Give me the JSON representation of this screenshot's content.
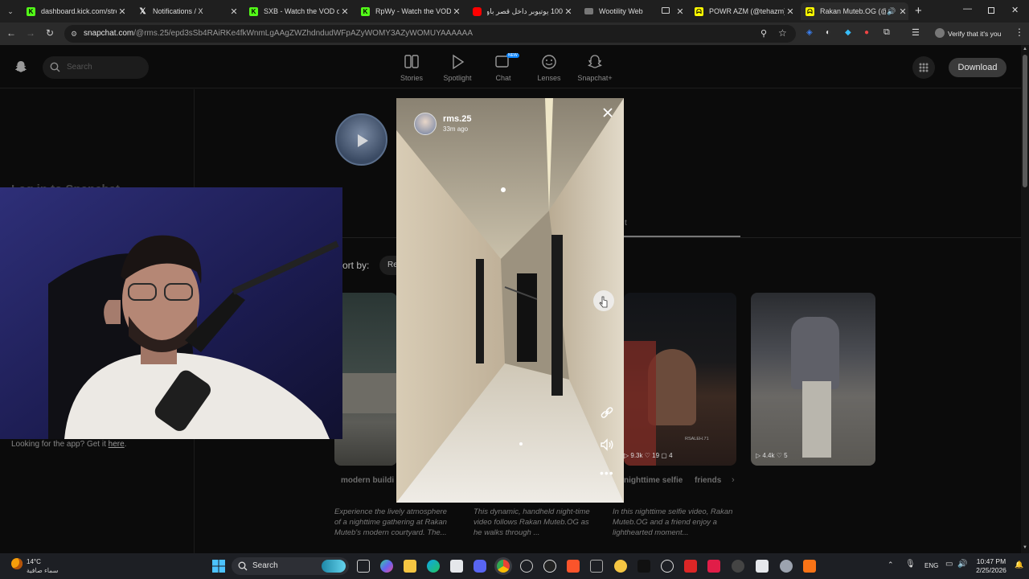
{
  "browser": {
    "tabs": [
      {
        "title": "dashboard.kick.com/strea",
        "icon": "kick-icon",
        "color": "#53fc18"
      },
      {
        "title": "Notifications / X",
        "icon": "x-icon",
        "color": "#ffffff"
      },
      {
        "title": "SXB - Watch the VOD on",
        "icon": "kick-icon",
        "color": "#53fc18"
      },
      {
        "title": "RpWy - Watch the VOD o",
        "icon": "kick-icon",
        "color": "#53fc18"
      },
      {
        "title": "100 يوتيوبر داخل قصر باور",
        "icon": "youtube-icon",
        "color": "#ff0000"
      },
      {
        "title": "Wootility Web",
        "icon": "wooting-icon",
        "color": "#888888"
      },
      {
        "title": "POWR AZM (@tehazm) |",
        "icon": "snapchat-icon",
        "color": "#fffc00"
      },
      {
        "title": "Rakan Muteb.OG (@",
        "icon": "snapchat-icon",
        "color": "#fffc00",
        "active": true
      }
    ],
    "url_host": "snapchat.com",
    "url_path": "/@rms.25/epd3sSb4RAiRKe4fkWnmLgAAgZWZhdndudWFpAZyWOMY3AZyWOMUYAAAAAA",
    "profile_label": "Verify that it's you"
  },
  "snapchat": {
    "search_placeholder": "Search",
    "nav": [
      {
        "label": "Stories",
        "icon": "stories-icon"
      },
      {
        "label": "Spotlight",
        "icon": "spotlight-play-icon"
      },
      {
        "label": "Chat",
        "icon": "chat-icon",
        "badge": "NEW"
      },
      {
        "label": "Lenses",
        "icon": "lenses-icon"
      },
      {
        "label": "Snapchat+",
        "icon": "snapchat-plus-icon"
      }
    ],
    "download_label": "Download",
    "left_pane_fragment": "Log in to Snapchat",
    "tab_fragment": "t",
    "sort_label": "ort by:",
    "sort_value": "Re",
    "app_prompt": "Looking for the app? Get it",
    "app_link": "here",
    "app_prompt_end": "."
  },
  "story": {
    "username": "rms.25",
    "time_ago": "33m ago"
  },
  "cards": [
    {
      "stat_views": "",
      "stat_likes": "",
      "stat_comments": "",
      "tag": "modern buildi",
      "desc": "Experience the lively atmosphere of a nighttime gathering at Rakan Muteb's modern courtyard. The..."
    },
    {
      "stat_views": "",
      "stat_likes": "",
      "stat_comments": "",
      "tag": "",
      "desc": "This dynamic, handheld night-time video follows Rakan Muteb.OG as he walks through ..."
    },
    {
      "stat_views": "9.3k",
      "stat_likes": "19",
      "stat_comments": "4",
      "tag": "nighttime selfie",
      "tag2": "friends",
      "desc": "In this nighttime selfie video, Rakan Muteb.OG and a friend enjoy a lighthearted moment..."
    },
    {
      "stat_views": "4.4k",
      "stat_likes": "5",
      "stat_comments": "",
      "tag": "",
      "desc": ""
    }
  ],
  "card3_watermark": "RSALEH.71",
  "taskbar": {
    "weather_temp": "14°C",
    "weather_desc": "سماء صافية",
    "search_label": "Search",
    "lang": "ENG",
    "time": "10:47 PM",
    "date": "2/25/2026"
  },
  "colors": {
    "snap_yellow": "#fffc00",
    "kick_green": "#53fc18",
    "accent_blue": "#0a84ff"
  }
}
